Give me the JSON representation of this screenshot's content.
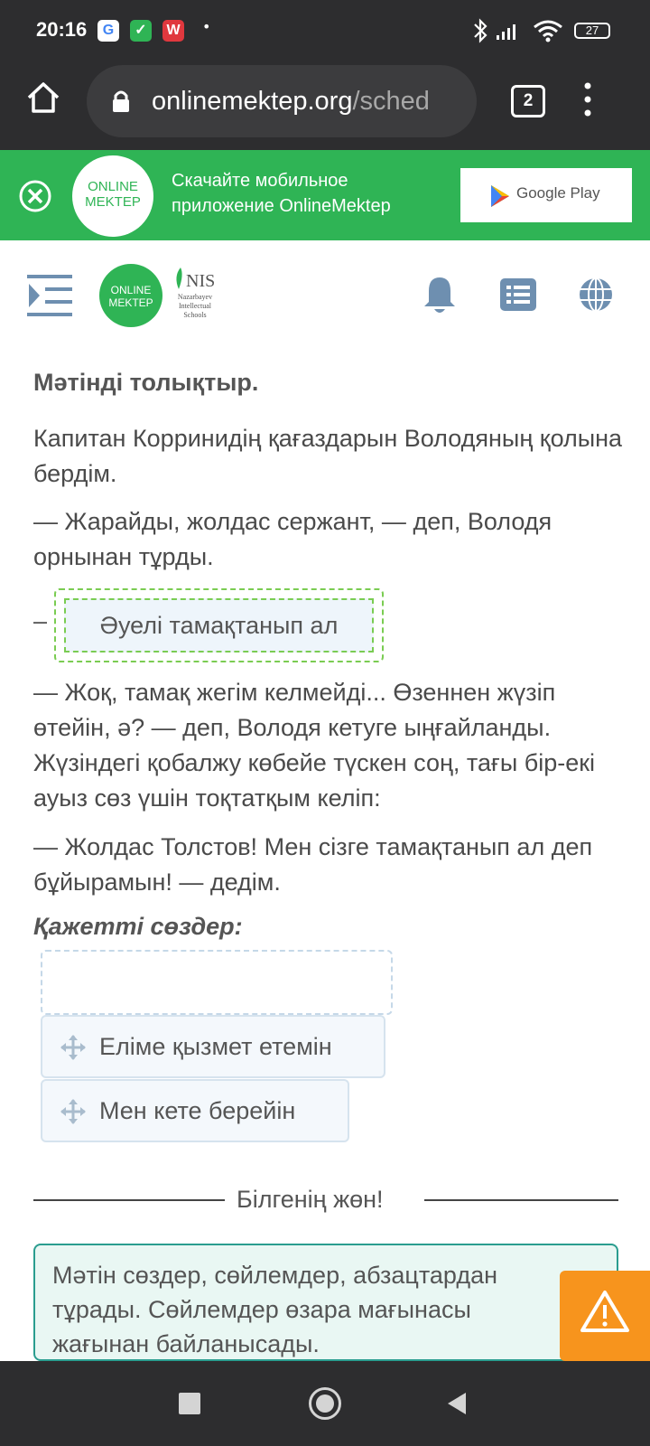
{
  "status_bar": {
    "time": "20:16",
    "app_icons": [
      {
        "icon": "google-icon",
        "glyph": "G",
        "bg": "#ffffff",
        "fg": "#4285f4"
      },
      {
        "icon": "shield-app-icon",
        "glyph": "✓",
        "bg": "#2fb455",
        "fg": "#ffffff"
      },
      {
        "icon": "wps-icon",
        "glyph": "W",
        "bg": "#e0383e",
        "fg": "#ffffff"
      }
    ],
    "dot": "•",
    "battery": "27"
  },
  "browser": {
    "url_domain": "onlinemektep.org",
    "url_path": "/sched",
    "tab_count": "2"
  },
  "banner": {
    "text_line1": "Скачайте мобильное",
    "text_line2": "приложение OnlineMektep",
    "logo_line1": "ONLINE",
    "logo_line2": "MEKTEP",
    "store_label": "Google Play"
  },
  "header": {
    "logo_line1": "ONLINE",
    "logo_line2": "MEKTEP",
    "nis_logo": "NIS",
    "nis_sub1": "Nazarbayev",
    "nis_sub2": "Intellectual",
    "nis_sub3": "Schools"
  },
  "task": {
    "instruction": "Мәтінді толықтыр.",
    "para1": "Капитан Корринидің қағаздарын Володяның қолына бердім.",
    "para2": "— Жарайды, жолдас сержант, — деп, Володя орнынан тұрды.",
    "dash": "–",
    "filled_answer": "Әуелі тамақтанып ал",
    "para3": "— Жоқ, тамақ жегім келмейді... Өзеннен жүзіп өтейін, ә? — деп, Володя кетуге ыңғайланды. Жүзіндегі қобалжу көбейе түскен соң, тағы бір-екі ауыз сөз үшін тоқтатқым келіп:",
    "para4": "— Жолдас Толстов! Мен сізге тамақтанып ал деп бұйырамын! — дедім."
  },
  "words": {
    "title": "Қажетті сөздер:",
    "options": [
      "Еліме қызмет етемін",
      "Мен кете берейін"
    ]
  },
  "section": {
    "title": "Білгенің жөн!",
    "info": "Мәтін сөздер, сөйлемдер, абзацтардан тұрады. Сөйлемдер өзара мағынасы жағынан байланысады."
  },
  "colors": {
    "accent_green": "#2fb455",
    "dashed_green": "#7acc52",
    "warning_orange": "#f7941d",
    "icon_blue": "#6e8fb0"
  }
}
